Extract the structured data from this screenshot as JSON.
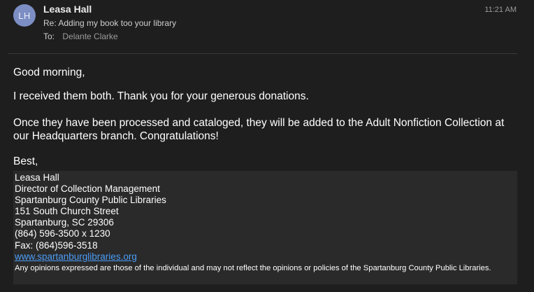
{
  "header": {
    "avatar_initials": "LH",
    "sender_name": "Leasa Hall",
    "time": "11:21 AM",
    "subject": "Re: Adding my book too your library",
    "to_label": "To:",
    "to_value": "Delante Clarke"
  },
  "body": {
    "greeting": "Good morning,",
    "thanks": "I received them both. Thank you for your generous donations.",
    "processed": "Once they have been processed and cataloged, they will be added to the Adult Nonfiction Collection at our Headquarters branch. Congratulations!",
    "closing": "Best,"
  },
  "signature": {
    "name": "Leasa Hall",
    "title": "Director of Collection Management",
    "org": "Spartanburg County Public Libraries",
    "street": "151 South Church Street",
    "city": "Spartanburg, SC 29306",
    "phone": "(864) 596-3500 x 1230",
    "fax": "Fax: (864)596-3518",
    "website": "www.spartanburglibraries.org",
    "disclaimer": "Any opinions expressed are those of the individual and may not reflect the opinions or policies of the Spartanburg County Public Libraries."
  },
  "colors": {
    "background": "#1e1e1e",
    "signature_bg": "#2a2a2a",
    "link": "#4a9df8",
    "avatar": "#7c8ec4"
  }
}
